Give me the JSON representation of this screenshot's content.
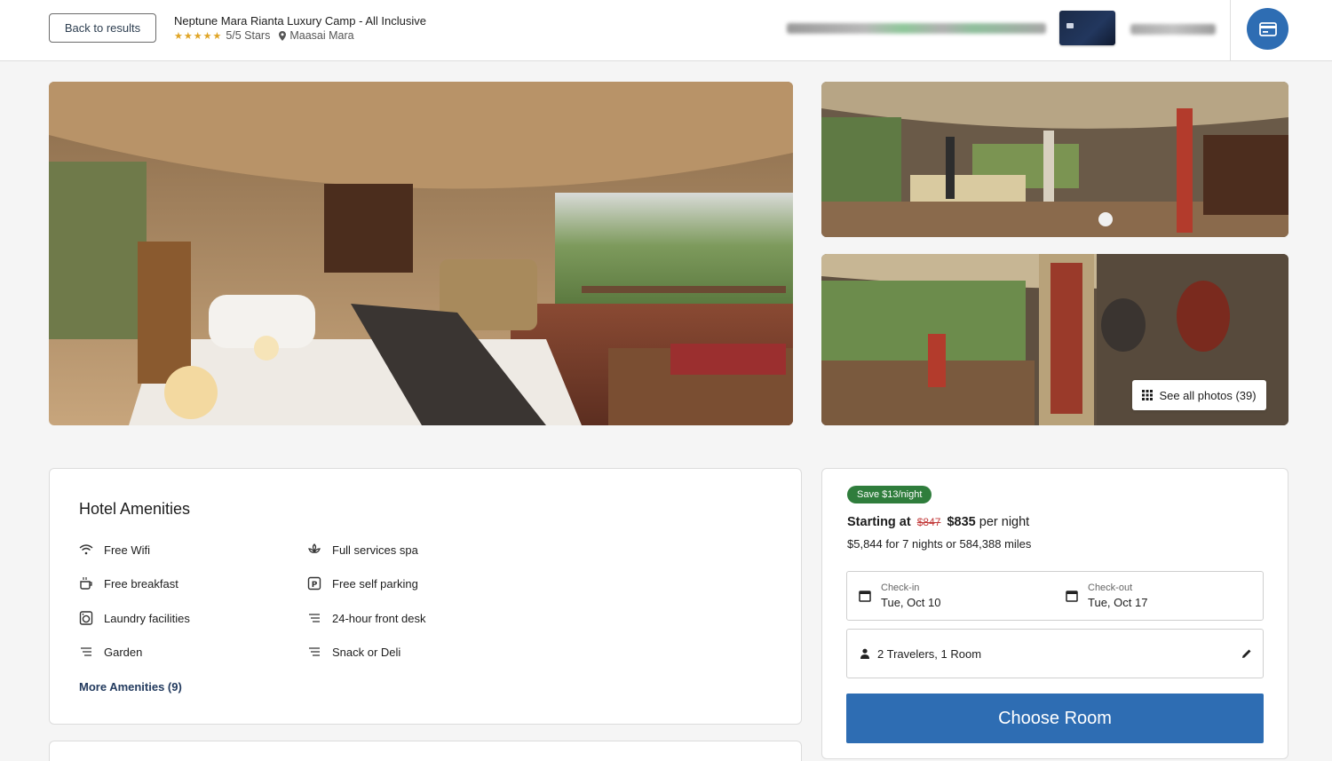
{
  "header": {
    "back_label": "Back to results",
    "hotel_name": "Neptune Mara Rianta Luxury Camp - All Inclusive",
    "stars": "★★★★★",
    "rating": "5/5 Stars",
    "location": "Maasai Mara"
  },
  "gallery": {
    "see_all_label": "See all photos (39)"
  },
  "amenities": {
    "title": "Hotel Amenities",
    "items": [
      {
        "label": "Free Wifi",
        "icon": "wifi-icon"
      },
      {
        "label": "Full services spa",
        "icon": "spa-icon"
      },
      {
        "label": "Free breakfast",
        "icon": "coffee-icon"
      },
      {
        "label": "Free self parking",
        "icon": "parking-icon"
      },
      {
        "label": "Laundry facilities",
        "icon": "laundry-icon"
      },
      {
        "label": "24-hour front desk",
        "icon": "list-icon"
      },
      {
        "label": "Garden",
        "icon": "list-icon"
      },
      {
        "label": "Snack or Deli",
        "icon": "list-icon"
      }
    ],
    "more_label": "More Amenities (9)"
  },
  "booking": {
    "save_badge": "Save $13/night",
    "starting_at": "Starting at",
    "old_price": "$847",
    "price": "$835",
    "per_night": "per night",
    "total": "$5,844 for 7 nights or 584,388 miles",
    "checkin_label": "Check-in",
    "checkin_value": "Tue, Oct 10",
    "checkout_label": "Check-out",
    "checkout_value": "Tue, Oct 17",
    "travelers": "2 Travelers, 1 Room",
    "choose_label": "Choose Room"
  },
  "colors": {
    "accent": "#2e6db3",
    "save_green": "#2f7d3c",
    "star_gold": "#e0a526",
    "strike_red": "#c23a3a"
  }
}
